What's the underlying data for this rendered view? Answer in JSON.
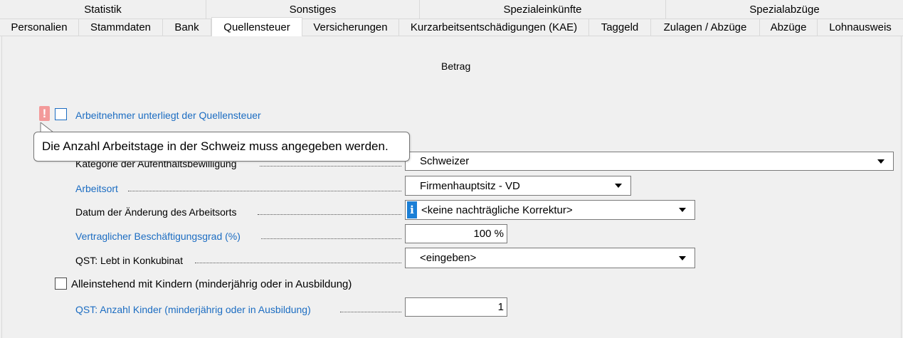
{
  "tabs_top": [
    {
      "label": "Statistik"
    },
    {
      "label": "Sonstiges"
    },
    {
      "label": "Spezialeinkünfte"
    },
    {
      "label": "Spezialabzüge"
    }
  ],
  "tabs_bottom": [
    {
      "label": "Personalien"
    },
    {
      "label": "Stammdaten"
    },
    {
      "label": "Bank"
    },
    {
      "label": "Quellensteuer",
      "active": true
    },
    {
      "label": "Versicherungen"
    },
    {
      "label": "Kurzarbeitsentschädigungen (KAE)"
    },
    {
      "label": "Taggeld"
    },
    {
      "label": "Zulagen / Abzüge"
    },
    {
      "label": "Abzüge"
    },
    {
      "label": "Lohnausweis"
    }
  ],
  "panel": {
    "column_header": "Betrag",
    "subject_checkbox_label": "Arbeitnehmer unterliegt der Quellensteuer",
    "tooltip": "Die Anzahl Arbeitstage in der Schweiz muss angegeben werden.",
    "fields": {
      "kategorie": {
        "label": "Kategorie der Aufenthaltsbewilligung",
        "value": "Schweizer"
      },
      "arbeitsort": {
        "label": "Arbeitsort",
        "value": "Firmenhauptsitz - VD"
      },
      "datum": {
        "label": "Datum der Änderung des Arbeitsorts",
        "value": "<keine nachträgliche Korrektur>"
      },
      "grad": {
        "label": "Vertraglicher Beschäftigungsgrad (%)",
        "value": "100 %"
      },
      "konkubinat": {
        "label": "QST: Lebt in Konkubinat",
        "value": "<eingeben>"
      },
      "kinder": {
        "label": "QST: Anzahl Kinder (minderjährig oder in Ausbildung)",
        "value": "1"
      }
    },
    "alleinstehend_label": "Alleinstehend mit Kindern (minderjährig oder in Ausbildung)"
  },
  "colors": {
    "link_blue": "#1c6dc2",
    "warning_pink": "#f39a9a",
    "info_blue": "#1b7fd6"
  }
}
